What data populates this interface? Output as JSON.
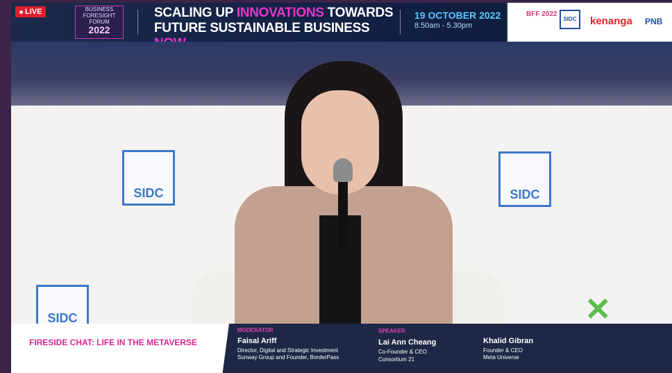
{
  "live_badge": "LIVE",
  "forum": {
    "line1": "BUSINESS",
    "line2": "FORESIGHT",
    "line3": "FORUM",
    "year": "2022"
  },
  "headline": {
    "line1_a": "SCALING UP ",
    "line1_b": "INNOVATIONS",
    "line1_c": " TOWARDS",
    "line2_a": "FUTURE SUSTAINABLE BUSINESS ",
    "line2_b": "NOW"
  },
  "event": {
    "date": "19 OCTOBER 2022",
    "time": "8.50am - 5.30pm"
  },
  "sponsors": {
    "bff": "BFF 2022",
    "sidc": "SIDC",
    "kenanga": "kenanga",
    "pnb": "PNB"
  },
  "video": {
    "backdrop_logo": "SIDC"
  },
  "lower_third": {
    "session_title": "FIRESIDE CHAT: LIFE IN THE METAVERSE",
    "moderator": {
      "role": "MODERATOR",
      "name": "Faisal Ariff",
      "line1": "Director, Digital and Strategic Investment",
      "line2": "Sunway Group and Founder, BorderPass"
    },
    "speaker1": {
      "role": "SPEAKER",
      "name": "Lai Ann Cheang",
      "line1": "Co-Founder & CEO",
      "line2": "Consortium 21"
    },
    "speaker2": {
      "name": "Khalid Gibran",
      "line1": "Founder & CEO",
      "line2": "Meta Universe"
    }
  }
}
